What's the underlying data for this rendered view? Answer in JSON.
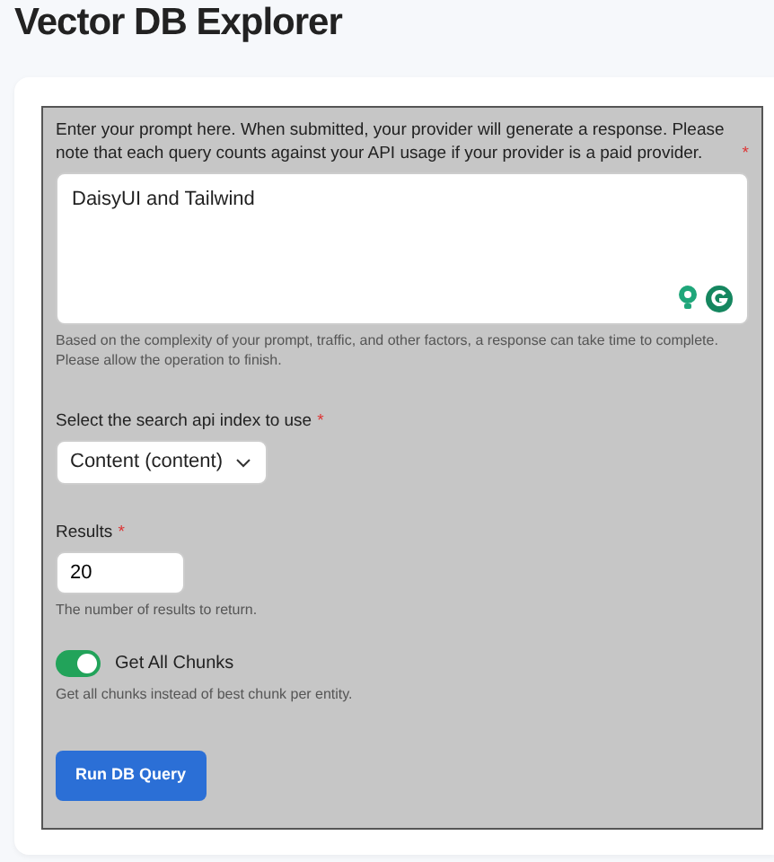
{
  "title": "Vector DB Explorer",
  "prompt": {
    "label": "Enter your prompt here. When submitted, your provider will generate a response. Please note that each query counts against your API usage if your provider is a paid provider.",
    "required": true,
    "value": "DaisyUI and Tailwind",
    "hint": "Based on the complexity of your prompt, traffic, and other factors, a response can take time to complete. Please allow the operation to finish."
  },
  "index_select": {
    "label": "Select the search api index to use",
    "required": true,
    "value": "Content (content)"
  },
  "results": {
    "label": "Results",
    "required": true,
    "value": "20",
    "hint": "The number of results to return."
  },
  "chunks": {
    "label": "Get All Chunks",
    "on": true,
    "hint": "Get all chunks instead of best chunk per entity."
  },
  "run_button": "Run DB Query",
  "required_mark": "*"
}
